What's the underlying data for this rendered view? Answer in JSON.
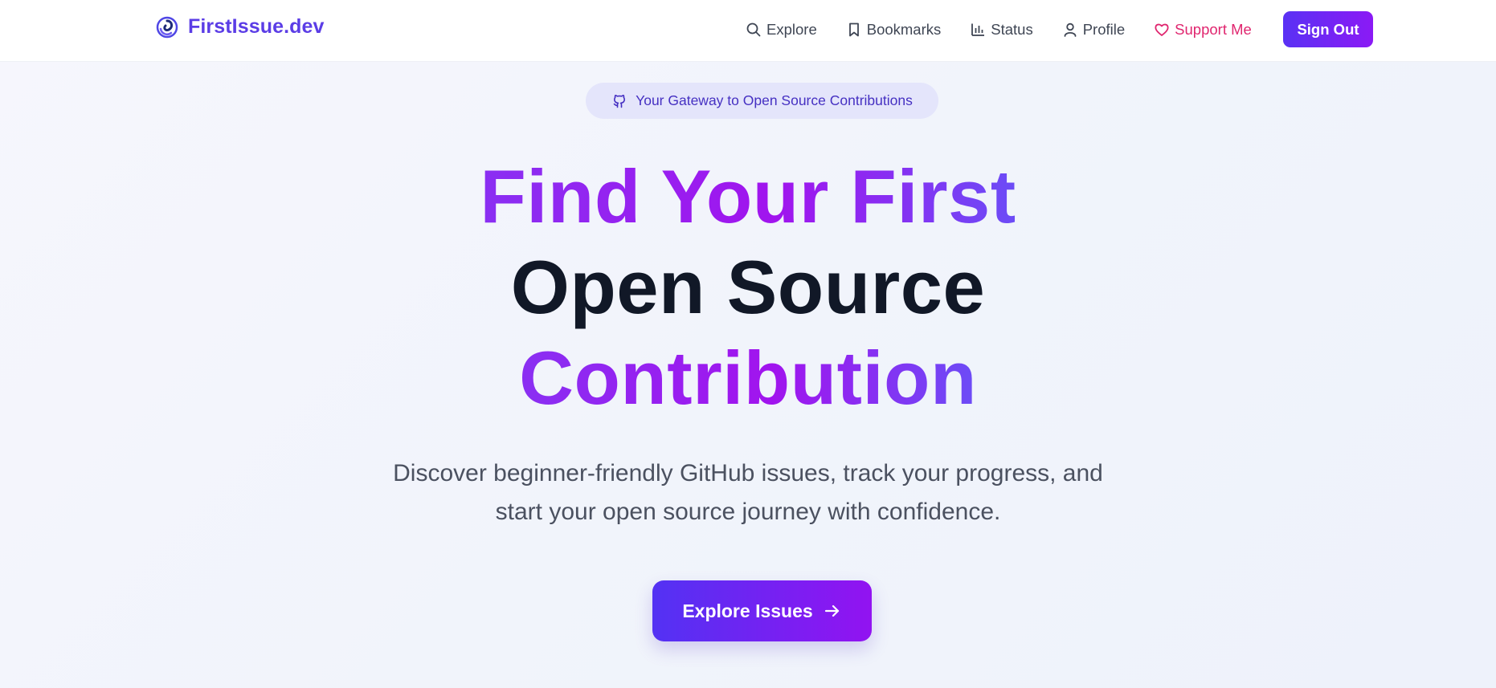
{
  "brand": {
    "name": "FirstIssue.dev",
    "logo_icon": "spiral-logo-icon"
  },
  "nav": {
    "items": [
      {
        "label": "Explore",
        "icon": "search-icon"
      },
      {
        "label": "Bookmarks",
        "icon": "bookmark-icon"
      },
      {
        "label": "Status",
        "icon": "bar-chart-icon"
      },
      {
        "label": "Profile",
        "icon": "user-icon"
      },
      {
        "label": "Support Me",
        "icon": "heart-icon",
        "color": "#e0266f"
      }
    ],
    "sign_out_label": "Sign Out"
  },
  "hero": {
    "pill_text": "Your Gateway to Open Source Contributions",
    "pill_icon": "github-icon",
    "title_line1": "Find Your First",
    "title_line2": "Open Source",
    "title_line3": "Contribution",
    "subtitle_line1": "Discover beginner-friendly GitHub issues, track your progress, and",
    "subtitle_line2": "start your open source journey with confidence.",
    "cta_label": "Explore Issues",
    "cta_icon": "arrow-right-icon"
  },
  "colors": {
    "brand": "#5b3de6",
    "accent_gradient_start": "#5a31f4",
    "accent_gradient_end": "#8b1af5",
    "support": "#e0266f",
    "heading_dark": "#111827"
  }
}
